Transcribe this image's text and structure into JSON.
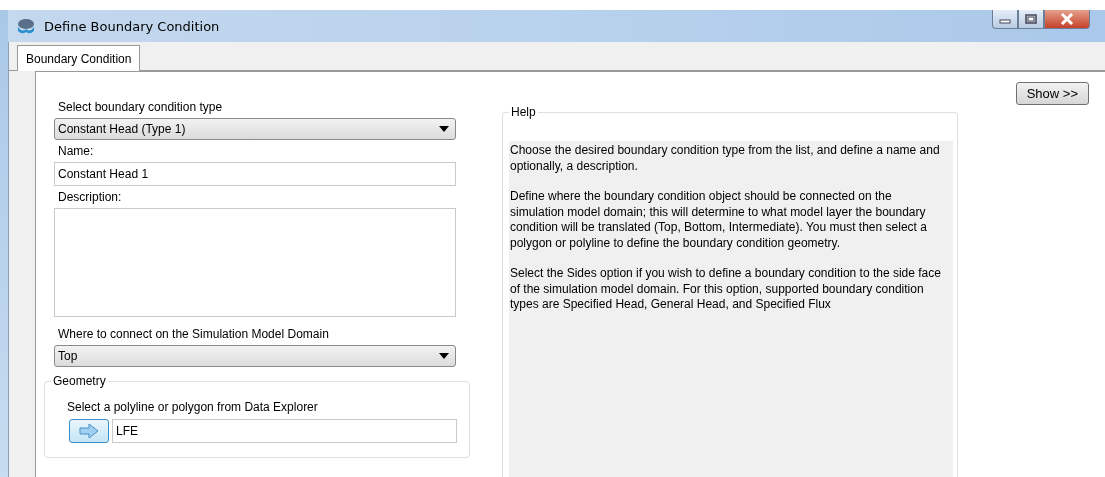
{
  "window": {
    "title": "Define Boundary Condition"
  },
  "tabs": [
    {
      "label": "Boundary Condition",
      "selected": true
    }
  ],
  "type_field": {
    "label": "Select boundary condition type",
    "value": "Constant Head (Type 1)"
  },
  "name_field": {
    "label": "Name:",
    "value": "Constant Head 1"
  },
  "description_field": {
    "label": "Description:"
  },
  "connect_field": {
    "label": "Where to connect on the Simulation Model Domain",
    "value": "Top"
  },
  "geometry": {
    "title": "Geometry",
    "label": "Select a polyline or polygon from Data Explorer",
    "value": "LFE"
  },
  "help": {
    "title": "Help",
    "paragraphs": [
      "Choose the desired boundary condition type from the list, and define a name and optionally, a description.",
      "Define where the boundary condition object should be connected on the simulation model domain; this will determine to what model layer the boundary condition will be translated (Top, Bottom, Intermediate).  You must then select a polygon or polyline to define the boundary condition geometry.",
      "Select the Sides option if you wish to define a boundary condition to the side face of the simulation model domain.  For this option, supported boundary condition types are Specified Head, General Head, and Specified Flux"
    ]
  },
  "show_button": "Show >>"
}
